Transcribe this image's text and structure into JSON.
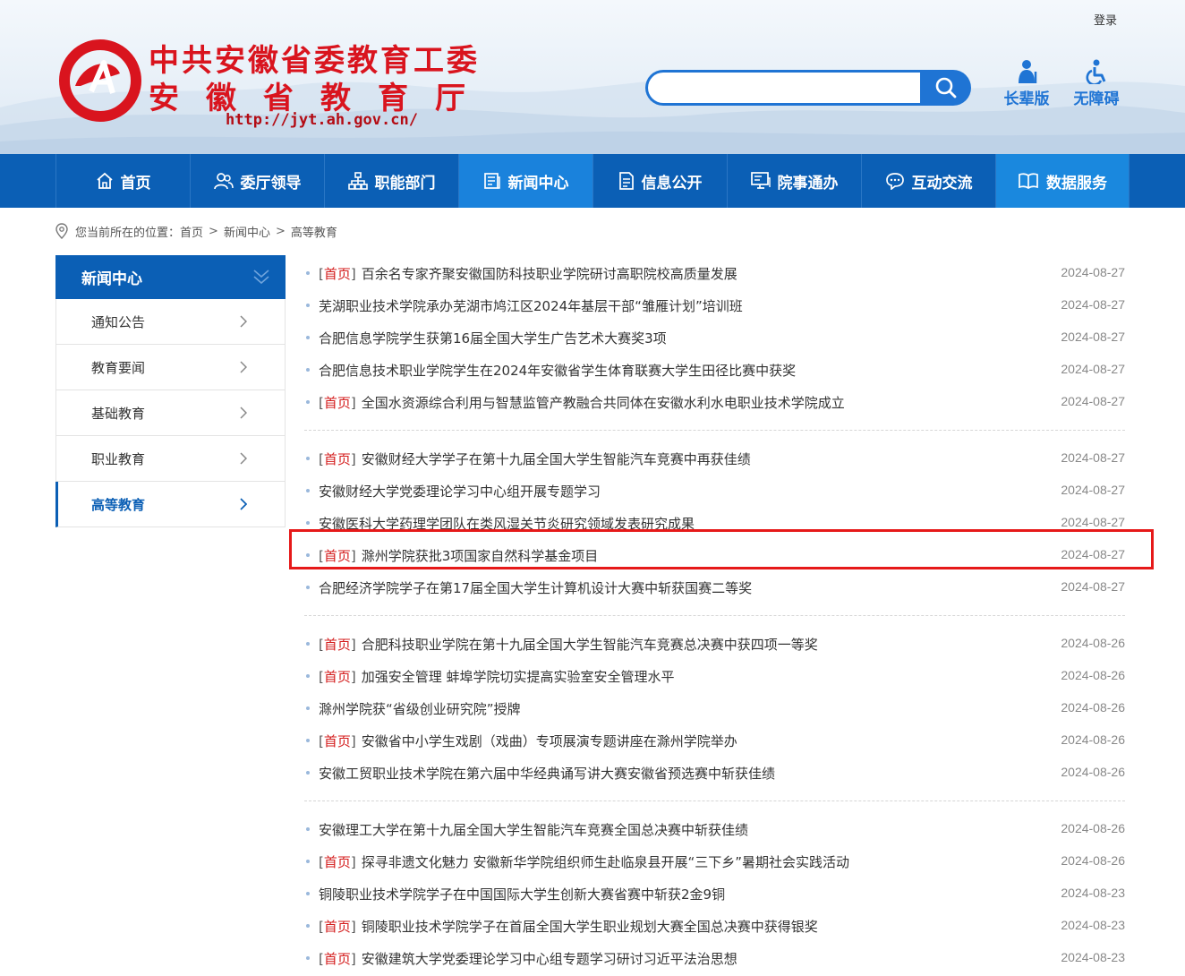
{
  "header": {
    "login": "登录",
    "logo_line1": "中共安徽省委教育工委",
    "logo_line2": "安徽省教育厅",
    "logo_url": "http://jyt.ah.gov.cn/",
    "search_placeholder": "",
    "tools": [
      {
        "label": "长辈版",
        "icon": "elder-icon"
      },
      {
        "label": "无障碍",
        "icon": "wheelchair-icon"
      }
    ]
  },
  "nav": {
    "items": [
      {
        "label": "首页",
        "icon": "home-icon"
      },
      {
        "label": "委厅领导",
        "icon": "leaders-icon"
      },
      {
        "label": "职能部门",
        "icon": "org-chart-icon"
      },
      {
        "label": "新闻中心",
        "icon": "news-icon",
        "active": true
      },
      {
        "label": "信息公开",
        "icon": "document-icon"
      },
      {
        "label": "院事通办",
        "icon": "monitor-icon"
      },
      {
        "label": "互动交流",
        "icon": "chat-icon"
      },
      {
        "label": "数据服务",
        "icon": "book-icon"
      }
    ]
  },
  "breadcrumb": {
    "prefix": "您当前所在的位置：",
    "items": [
      "首页",
      "新闻中心",
      "高等教育"
    ],
    "sep": ">"
  },
  "sidebar": {
    "title": "新闻中心",
    "items": [
      {
        "label": "通知公告"
      },
      {
        "label": "教育要闻"
      },
      {
        "label": "基础教育"
      },
      {
        "label": "职业教育"
      },
      {
        "label": "高等教育",
        "active": true
      }
    ]
  },
  "tag_text": "首页",
  "news_groups": [
    [
      {
        "tag": true,
        "title": "百余名专家齐聚安徽国防科技职业学院研讨高职院校高质量发展",
        "date": "2024-08-27"
      },
      {
        "tag": false,
        "title": "芜湖职业技术学院承办芜湖市鸠江区2024年基层干部“雏雁计划”培训班",
        "date": "2024-08-27"
      },
      {
        "tag": false,
        "title": "合肥信息学院学生获第16届全国大学生广告艺术大赛奖3项",
        "date": "2024-08-27"
      },
      {
        "tag": false,
        "title": "合肥信息技术职业学院学生在2024年安徽省学生体育联赛大学生田径比赛中获奖",
        "date": "2024-08-27"
      },
      {
        "tag": true,
        "title": "全国水资源综合利用与智慧监管产教融合共同体在安徽水利水电职业技术学院成立",
        "date": "2024-08-27"
      }
    ],
    [
      {
        "tag": true,
        "title": "安徽财经大学学子在第十九届全国大学生智能汽车竞赛中再获佳绩",
        "date": "2024-08-27"
      },
      {
        "tag": false,
        "title": "安徽财经大学党委理论学习中心组开展专题学习",
        "date": "2024-08-27"
      },
      {
        "tag": false,
        "title": "安徽医科大学药理学团队在类风湿关节炎研究领域发表研究成果",
        "date": "2024-08-27"
      },
      {
        "tag": true,
        "title": "滁州学院获批3项国家自然科学基金项目",
        "date": "2024-08-27"
      },
      {
        "tag": false,
        "title": "合肥经济学院学子在第17届全国大学生计算机设计大赛中斩获国赛二等奖",
        "date": "2024-08-27"
      }
    ],
    [
      {
        "tag": true,
        "title": "合肥科技职业学院在第十九届全国大学生智能汽车竞赛总决赛中获四项一等奖",
        "date": "2024-08-26"
      },
      {
        "tag": true,
        "title": "加强安全管理 蚌埠学院切实提高实验室安全管理水平",
        "date": "2024-08-26"
      },
      {
        "tag": false,
        "title": "滁州学院获“省级创业研究院”授牌",
        "date": "2024-08-26"
      },
      {
        "tag": true,
        "title": "安徽省中小学生戏剧（戏曲）专项展演专题讲座在滁州学院举办",
        "date": "2024-08-26"
      },
      {
        "tag": false,
        "title": "安徽工贸职业技术学院在第六届中华经典诵写讲大赛安徽省预选赛中斩获佳绩",
        "date": "2024-08-26"
      }
    ],
    [
      {
        "tag": false,
        "title": "安徽理工大学在第十九届全国大学生智能汽车竞赛全国总决赛中斩获佳绩",
        "date": "2024-08-26"
      },
      {
        "tag": true,
        "title": "探寻非遗文化魅力 安徽新华学院组织师生赴临泉县开展“三下乡”暑期社会实践活动",
        "date": "2024-08-26"
      },
      {
        "tag": false,
        "title": "铜陵职业技术学院学子在中国国际大学生创新大赛省赛中斩获2金9铜",
        "date": "2024-08-23"
      },
      {
        "tag": true,
        "title": "铜陵职业技术学院学子在首届全国大学生职业规划大赛全国总决赛中获得银奖",
        "date": "2024-08-23"
      },
      {
        "tag": true,
        "title": "安徽建筑大学党委理论学习中心组专题学习研讨习近平法治思想",
        "date": "2024-08-23"
      }
    ]
  ],
  "colors": {
    "primary": "#0b5fb5",
    "active_nav": "#1a82dc",
    "tag_red": "#d41c1c",
    "highlight": "#e61919"
  }
}
